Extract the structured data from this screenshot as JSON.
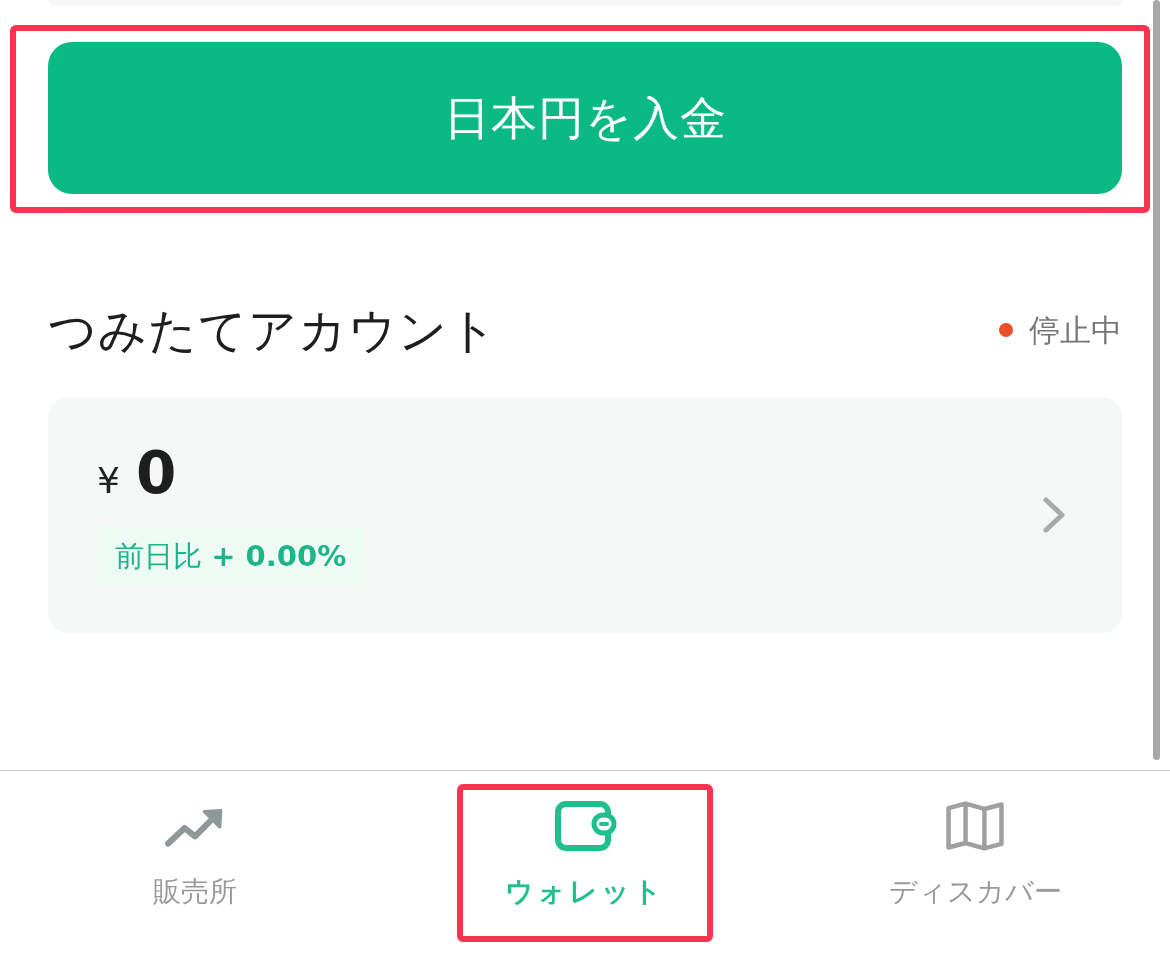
{
  "deposit_button": {
    "label": "日本円を入金",
    "highlighted": true
  },
  "account": {
    "title": "つみたてアカウント",
    "status": {
      "label": "停止中",
      "active": false
    },
    "balance": {
      "currency": "¥",
      "amount": "0"
    },
    "change": "前日比 **+ 0.00%**"
  },
  "bottom_nav": [
    {
      "label": "販売所",
      "kind": "trend",
      "selected": false,
      "highlighted": false
    },
    {
      "label": "ウォレット",
      "kind": "wallet",
      "selected": true,
      "highlighted": true
    },
    {
      "label": "ディスカバー",
      "kind": "map",
      "selected": false,
      "highlighted": false
    }
  ]
}
